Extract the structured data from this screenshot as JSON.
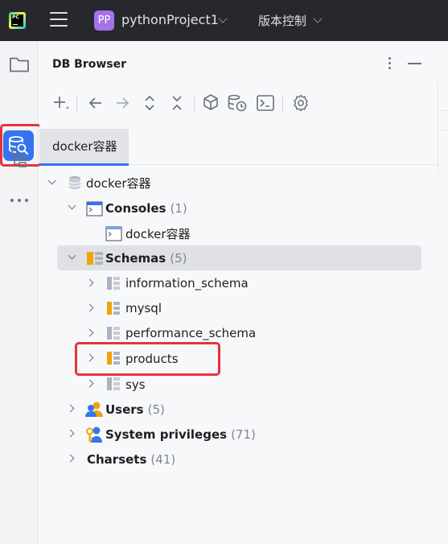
{
  "titlebar": {
    "app_logo_text": "PC",
    "project_badge": "PP",
    "project_name": "pythonProject1",
    "vcs_label": "版本控制"
  },
  "toolstrip": {
    "items": [
      {
        "icon": "folder-icon"
      },
      {
        "icon": "db-browser-icon",
        "active": true
      },
      {
        "icon": "structure-icon"
      },
      {
        "icon": "more-icon"
      }
    ]
  },
  "panel": {
    "title": "DB Browser",
    "toolbar": [
      {
        "icon": "add-icon"
      },
      {
        "icon": "back-arrow-icon"
      },
      {
        "icon": "forward-arrow-icon"
      },
      {
        "icon": "expand-all-icon"
      },
      {
        "icon": "collapse-all-icon"
      },
      {
        "icon": "object-properties-icon"
      },
      {
        "icon": "db-history-icon"
      },
      {
        "icon": "console-icon"
      },
      {
        "icon": "settings-icon"
      }
    ],
    "tab_label": "docker容器"
  },
  "tree": {
    "root": "docker容器",
    "consoles": {
      "label": "Consoles",
      "count": "(1)"
    },
    "console_item": "docker容器",
    "schemas": {
      "label": "Schemas",
      "count": "(5)"
    },
    "schema_items": [
      "information_schema",
      "mysql",
      "performance_schema",
      "products",
      "sys"
    ],
    "users": {
      "label": "Users",
      "count": "(5)"
    },
    "privileges": {
      "label": "System privileges",
      "count": "(71)"
    },
    "charsets": {
      "label": "Charsets",
      "count": "(41)"
    }
  },
  "colors": {
    "accent": "#3574f0",
    "highlight_box": "#e8323b",
    "schema_orange": "#f0a30a",
    "titlebar_bg": "#27282e"
  }
}
